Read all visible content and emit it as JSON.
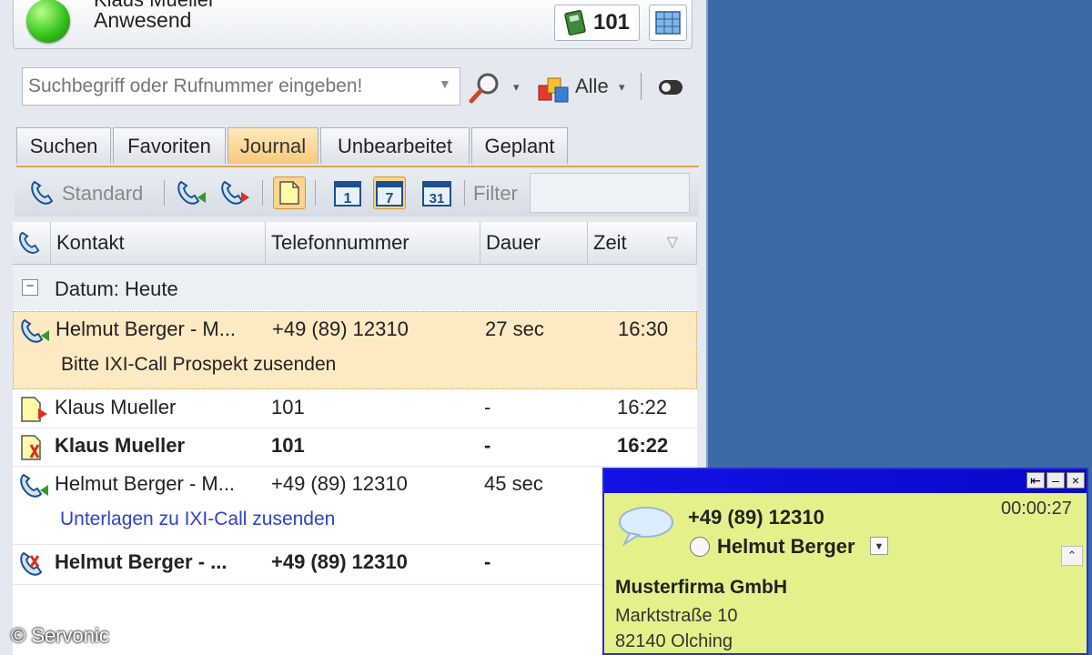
{
  "header": {
    "user_name": "Klaus Mueller",
    "status": "Anwesend",
    "extension": "101"
  },
  "search": {
    "placeholder": "Suchbegriff oder Rufnummer eingeben!",
    "scope_label": "Alle"
  },
  "tabs": [
    {
      "label": "Suchen"
    },
    {
      "label": "Favoriten"
    },
    {
      "label": "Journal",
      "active": true
    },
    {
      "label": "Unbearbeitet"
    },
    {
      "label": "Geplant"
    }
  ],
  "toolbar": {
    "standard_label": "Standard",
    "filter_label": "Filter",
    "filter_value": ""
  },
  "columns": {
    "contact": "Kontakt",
    "phone": "Telefonnummer",
    "duration": "Dauer",
    "time": "Zeit"
  },
  "group": {
    "label": "Datum: Heute"
  },
  "rows": [
    {
      "contact": "Helmut Berger - M...",
      "phone": "+49 (89) 12310",
      "duration": "27 sec",
      "time": "16:30",
      "note": "Bitte IXI-Call Prospekt zusenden"
    },
    {
      "contact": "Klaus Mueller",
      "phone": "101",
      "duration": "-",
      "time": "16:22"
    },
    {
      "contact": "Klaus Mueller",
      "phone": "101",
      "duration": "-",
      "time": "16:22"
    },
    {
      "contact": "Helmut Berger - M...",
      "phone": "+49 (89) 12310",
      "duration": "45 sec",
      "time": "",
      "note": "Unterlagen zu IXI-Call zusenden"
    },
    {
      "contact": "Helmut Berger - ...",
      "phone": "+49 (89) 12310",
      "duration": "-",
      "time": ""
    }
  ],
  "popup": {
    "number": "+49 (89) 12310",
    "timer": "00:00:27",
    "contact": "Helmut Berger",
    "company": "Musterfirma GmbH",
    "street": "Marktstraße 10",
    "city": "82140 Olching"
  },
  "copyright": "© Servonic",
  "colors": {
    "selected_row": "#fde9c2",
    "active_tab": "#f9c97a",
    "popup_body": "#e4f08a",
    "popup_title": "#1212e6",
    "desktop": "#3c6aa6",
    "link_note": "#2f3fd0"
  },
  "icons": [
    "presence-icon",
    "phone-book-icon",
    "grid-icon",
    "magnifier-icon",
    "cubes-icon",
    "toggle-icon",
    "phone-standard-icon",
    "incoming-call-icon",
    "outgoing-call-icon",
    "note-icon",
    "day-icon",
    "week-icon",
    "month-icon",
    "sort-icon",
    "speech-bubble-icon"
  ]
}
